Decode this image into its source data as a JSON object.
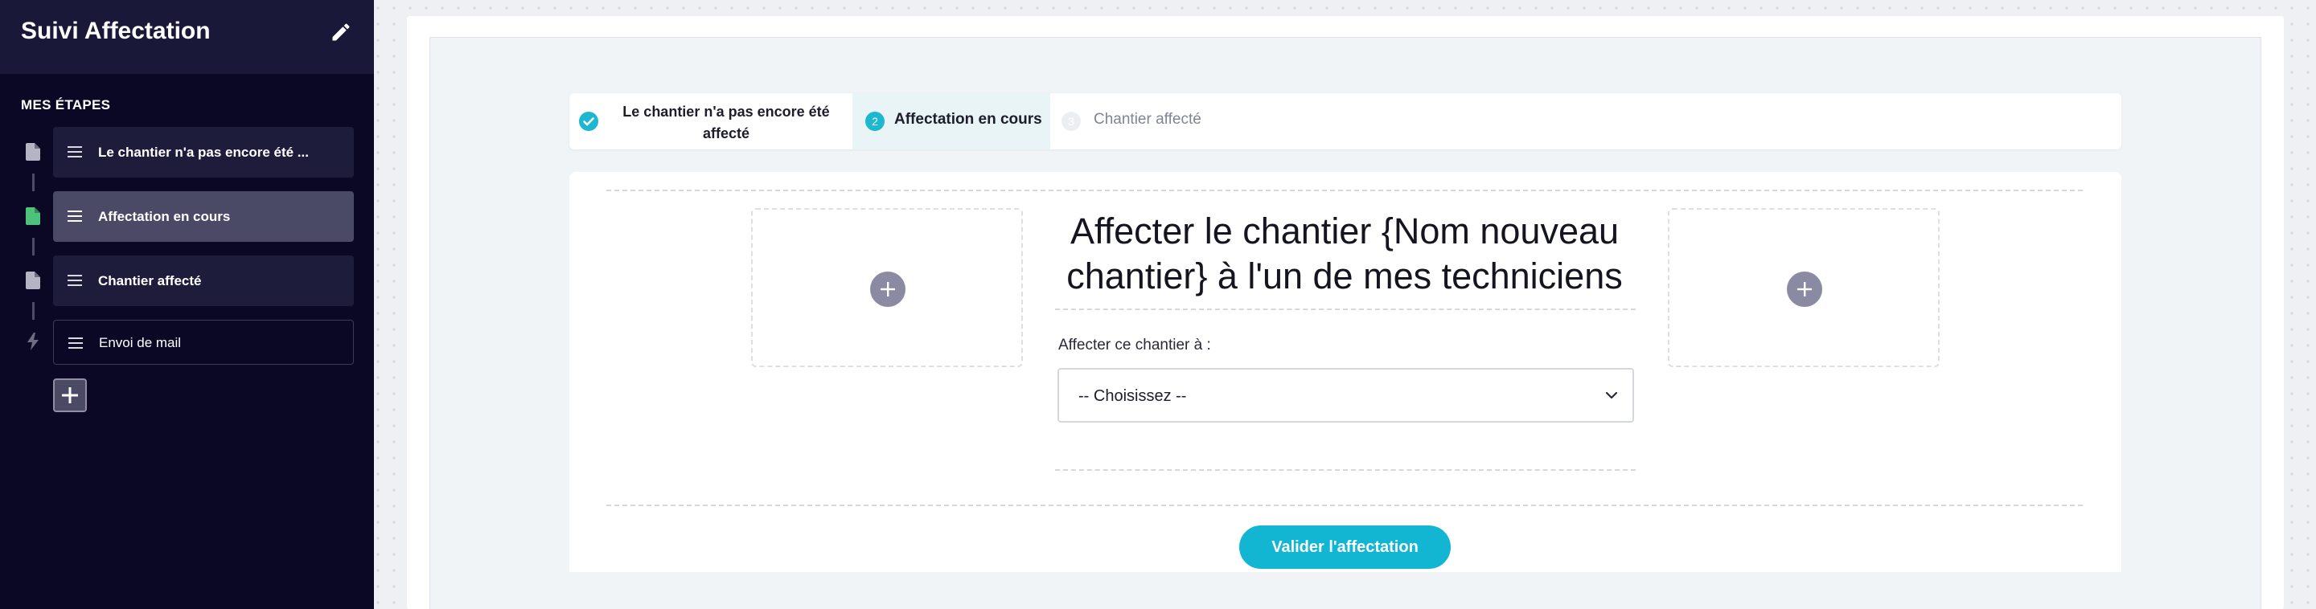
{
  "sidebar": {
    "title": "Suivi Affectation",
    "section_label": "MES ÉTAPES",
    "steps": [
      {
        "label": "Le chantier n'a pas encore été ...",
        "icon": "document-icon"
      },
      {
        "label": "Affectation en cours",
        "icon": "document-icon"
      },
      {
        "label": "Chantier affecté",
        "icon": "document-icon"
      },
      {
        "label": "Envoi de mail",
        "icon": "lightning-icon"
      }
    ]
  },
  "stepper": {
    "steps": [
      {
        "number": "",
        "label": "Le chantier n'a pas encore été affecté",
        "state": "done"
      },
      {
        "number": "2",
        "label": "Affectation en cours",
        "state": "current"
      },
      {
        "number": "3",
        "label": "Chantier affecté",
        "state": "upcoming"
      }
    ]
  },
  "form": {
    "heading": "Affecter le chantier {Nom nouveau chantier} à l'un de mes techniciens",
    "field_label": "Affecter ce chantier à :",
    "select_value": "-- Choisissez --",
    "submit_label": "Valider l'affectation"
  },
  "colors": {
    "sidebar_bg": "#0b0826",
    "accent": "#12b6d3",
    "active_step": "#4a4966",
    "done_step_icon": "#4cc27a"
  }
}
